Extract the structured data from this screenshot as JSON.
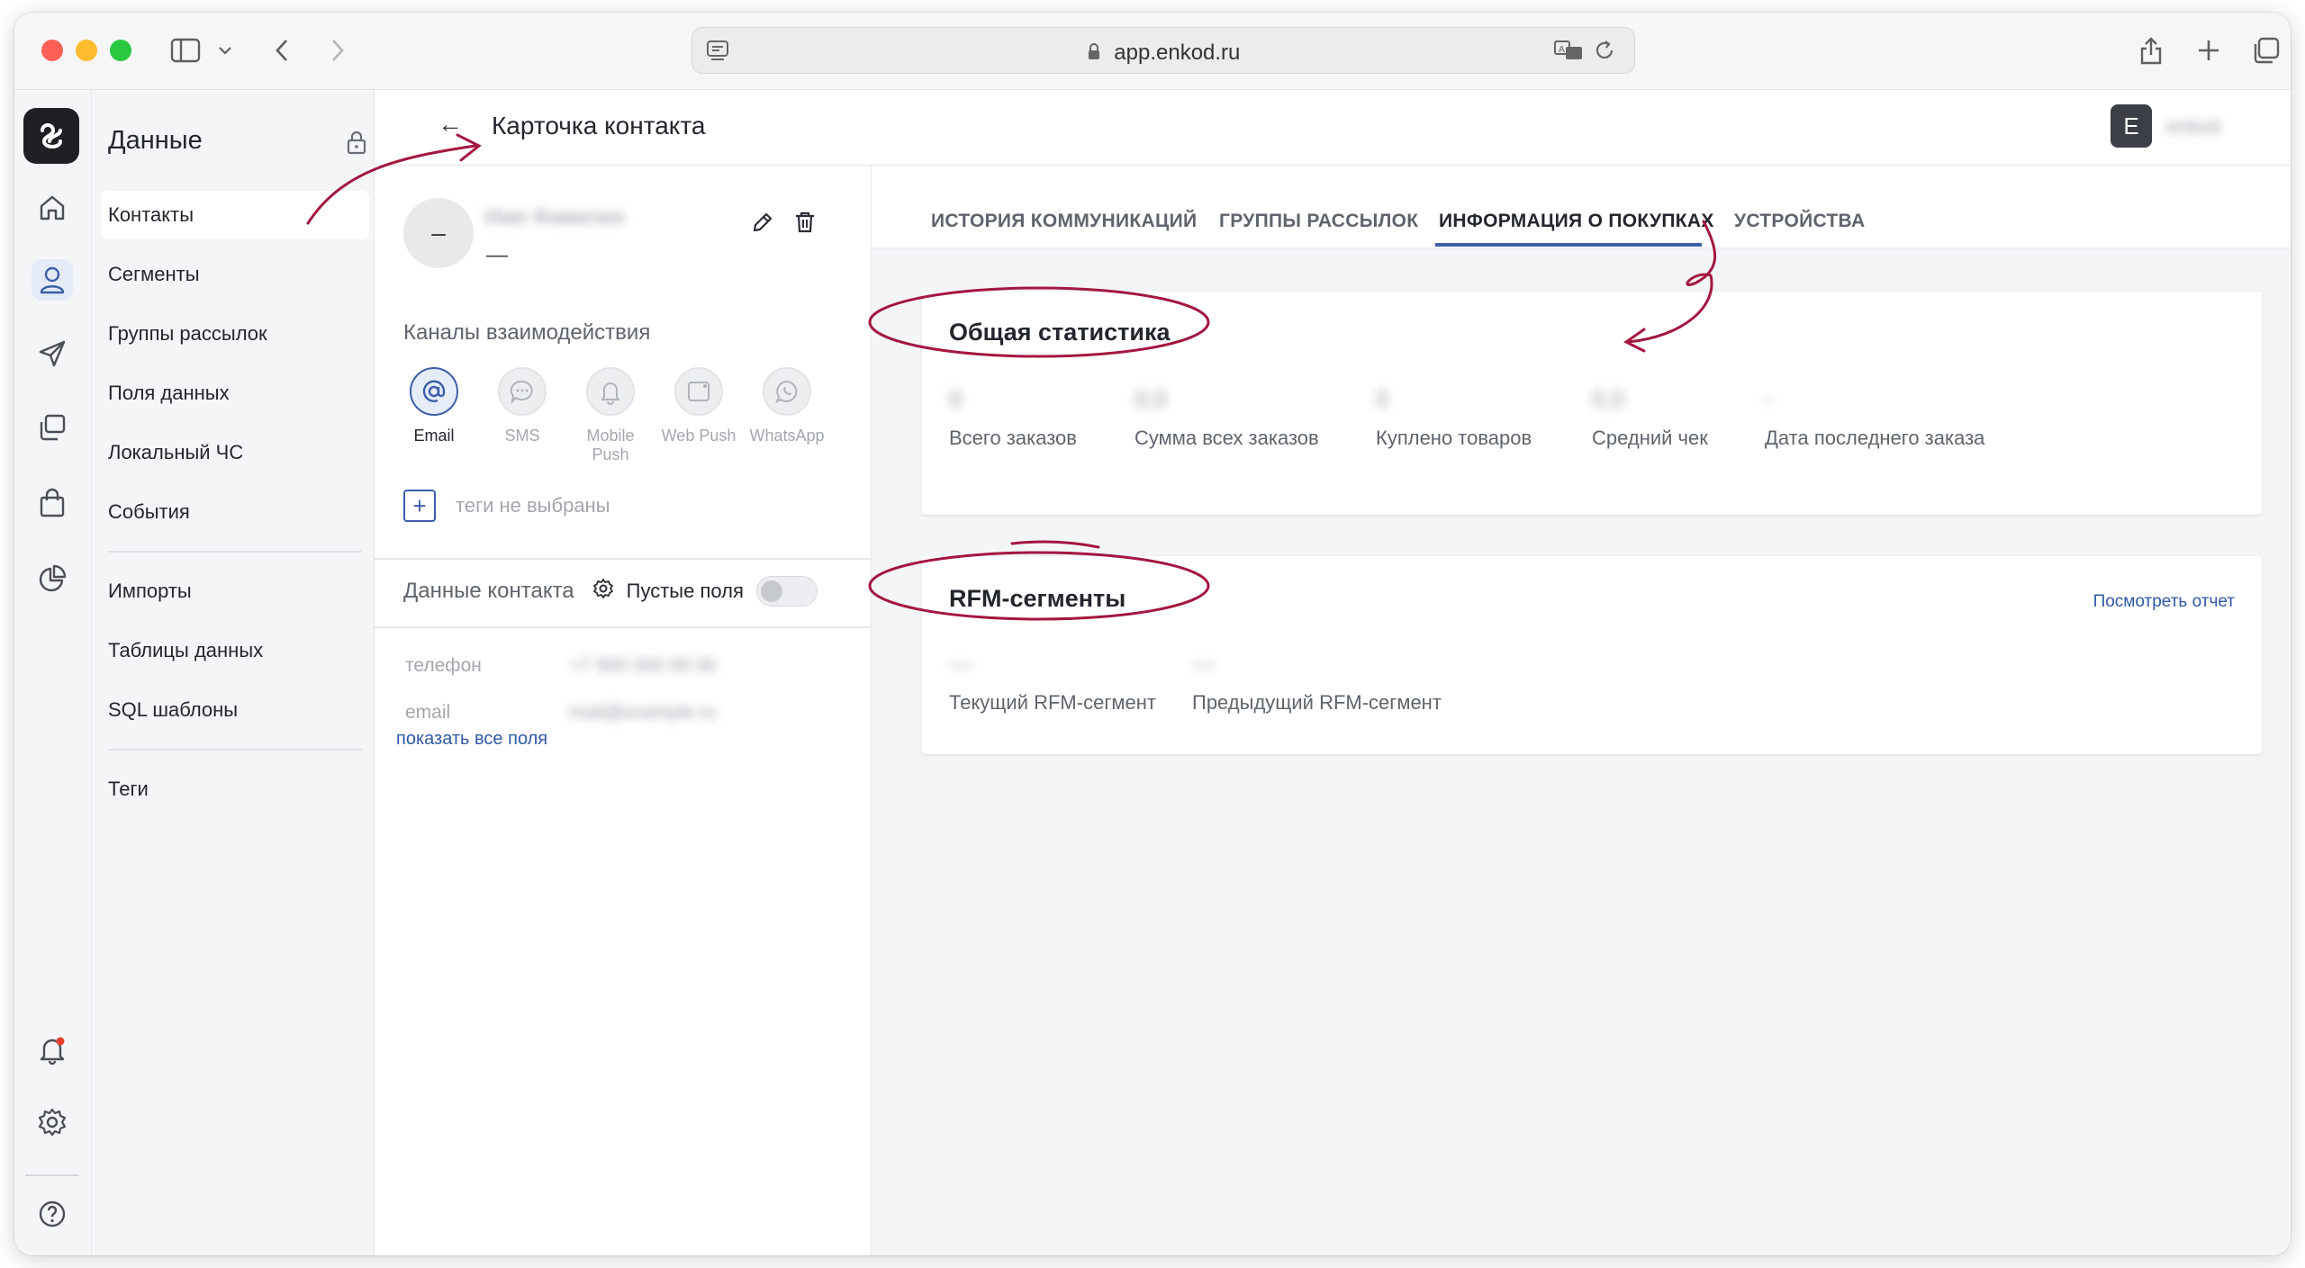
{
  "browser": {
    "url": "app.enkod.ru"
  },
  "sidebar": {
    "title": "Данные",
    "items": [
      {
        "label": "Контакты"
      },
      {
        "label": "Сегменты"
      },
      {
        "label": "Группы рассылок"
      },
      {
        "label": "Поля данных"
      },
      {
        "label": "Локальный ЧС"
      },
      {
        "label": "События"
      },
      {
        "label": "Импорты"
      },
      {
        "label": "Таблицы данных"
      },
      {
        "label": "SQL шаблоны"
      },
      {
        "label": "Теги"
      }
    ]
  },
  "header": {
    "back": "←",
    "title": "Карточка контакта",
    "avatar_letter": "E",
    "user_name": "enkod"
  },
  "contact": {
    "avatar_text": "–",
    "name": "Имя Фамилия",
    "subtitle": "—",
    "channels_title": "Каналы взаимодействия",
    "channels": [
      {
        "label": "Email"
      },
      {
        "label": "SMS"
      },
      {
        "label": "Mobile Push"
      },
      {
        "label": "Web Push"
      },
      {
        "label": "WhatsApp"
      }
    ],
    "tags_plus": "+",
    "tags_text": "теги не выбраны",
    "data_title": "Данные контакта",
    "empty_fields": "Пустые поля",
    "fields": [
      {
        "label": "телефон",
        "value": "+7 900 000 00 00"
      },
      {
        "label": "email",
        "value": "mail@example.ru"
      }
    ],
    "show_all": "показать все поля"
  },
  "tabs": [
    {
      "label": "ИСТОРИЯ КОММУНИКАЦИЙ"
    },
    {
      "label": "ГРУППЫ РАССЫЛОК"
    },
    {
      "label": "ИНФОРМАЦИЯ О ПОКУПКАХ"
    },
    {
      "label": "УСТРОЙСТВА"
    }
  ],
  "general_stats": {
    "title": "Общая статистика",
    "items": [
      {
        "value": "0",
        "label": "Всего заказов"
      },
      {
        "value": "0,0",
        "label": "Сумма всех заказов"
      },
      {
        "value": "0",
        "label": "Куплено товаров"
      },
      {
        "value": "0,0",
        "label": "Средний чек"
      },
      {
        "value": "-",
        "label": "Дата последнего заказа"
      }
    ]
  },
  "rfm": {
    "title": "RFM-сегменты",
    "report_link": "Посмотреть отчет",
    "items": [
      {
        "value": "—",
        "label": "Текущий RFM-сегмент"
      },
      {
        "value": "—",
        "label": "Предыдущий RFM-сегмент"
      }
    ]
  },
  "colors": {
    "accent": "#3d5ea8",
    "annotation": "#a3173f"
  }
}
